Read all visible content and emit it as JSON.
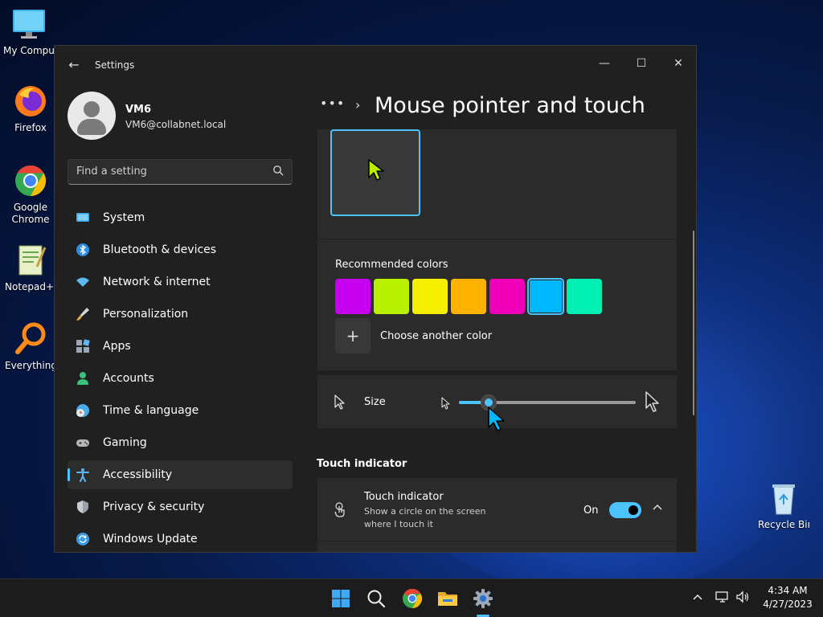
{
  "desktop": {
    "icons": [
      {
        "label": "My Computer"
      },
      {
        "label": "Firefox"
      },
      {
        "label": "Google Chrome"
      },
      {
        "label": "Notepad++"
      },
      {
        "label": "Everything"
      },
      {
        "label": "Recycle Bin"
      }
    ]
  },
  "window": {
    "title": "Settings",
    "controls": {
      "minimize": "—",
      "maximize": "☐",
      "close": "✕"
    }
  },
  "profile": {
    "name": "VM6",
    "email": "VM6@collabnet.local"
  },
  "search": {
    "placeholder": "Find a setting"
  },
  "nav": {
    "items": [
      {
        "label": "System",
        "icon": "monitor-icon",
        "color": "#3aa0e6"
      },
      {
        "label": "Bluetooth & devices",
        "icon": "bluetooth-icon",
        "color": "#2b8de3"
      },
      {
        "label": "Network & internet",
        "icon": "wifi-icon",
        "color": "#5db8f0"
      },
      {
        "label": "Personalization",
        "icon": "brush-icon",
        "color": "#e5a64a"
      },
      {
        "label": "Apps",
        "icon": "apps-icon",
        "color": "#9aa5b5"
      },
      {
        "label": "Accounts",
        "icon": "person-icon",
        "color": "#3bc27a"
      },
      {
        "label": "Time & language",
        "icon": "globe-clock-icon",
        "color": "#4aa9e8"
      },
      {
        "label": "Gaming",
        "icon": "gamepad-icon",
        "color": "#b8b8b8"
      },
      {
        "label": "Accessibility",
        "icon": "accessibility-icon",
        "color": "#5cb6f2",
        "active": true
      },
      {
        "label": "Privacy & security",
        "icon": "shield-icon",
        "color": "#9aa0a8"
      },
      {
        "label": "Windows Update",
        "icon": "update-icon",
        "color": "#3b9ae6"
      }
    ]
  },
  "content": {
    "breadcrumb_more": "•••",
    "breadcrumb_sep": "›",
    "title": "Mouse pointer and touch",
    "recommended_colors_label": "Recommended colors",
    "swatches": [
      {
        "color": "#c400ee"
      },
      {
        "color": "#b8f000"
      },
      {
        "color": "#f5f000"
      },
      {
        "color": "#ffb100"
      },
      {
        "color": "#ef00b8"
      },
      {
        "color": "#00b8ff",
        "selected": true
      },
      {
        "color": "#00f0b4"
      }
    ],
    "add_color_symbol": "+",
    "choose_color_label": "Choose another color",
    "size_label": "Size",
    "size_value": 0.17,
    "touch_section_label": "Touch indicator",
    "touch_indicator": {
      "title": "Touch indicator",
      "description": "Show a circle on the screen where I touch it",
      "state": "On",
      "enabled": true
    }
  },
  "taskbar": {
    "clock_time": "4:34 AM",
    "clock_date": "4/27/2023"
  },
  "accent_color": "#4cc2ff"
}
